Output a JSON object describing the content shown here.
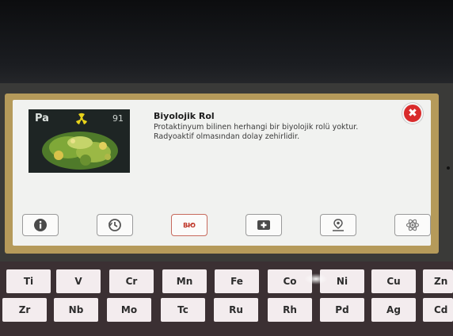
{
  "element": {
    "symbol": "Pa",
    "number": "91"
  },
  "card": {
    "title": "Biyolojik Rol",
    "body": "Protaktinyum bilinen herhangi bir biyolojik rolü yoktur. Radyoaktif olmasından dolay zehirlidir.",
    "close_icon": "✖"
  },
  "tabs": [
    {
      "icon": "info-icon"
    },
    {
      "icon": "history-icon"
    },
    {
      "icon": "bio-icon",
      "label": "BIO",
      "active": true
    },
    {
      "icon": "shield-cross-icon"
    },
    {
      "icon": "map-pin-icon"
    },
    {
      "icon": "atom-icon"
    }
  ],
  "periodic_table": {
    "row1": [
      "Ti",
      "V",
      "Cr",
      "Mn",
      "Fe",
      "Co",
      "Ni",
      "Cu",
      "Zn"
    ],
    "row2": [
      "Zr",
      "Nb",
      "Mo",
      "Tc",
      "Ru",
      "Rh",
      "Pd",
      "Ag",
      "Cd"
    ]
  },
  "colors": {
    "frame": "#b59a5a",
    "close": "#d92b2b",
    "bio_accent": "#c0392b"
  }
}
